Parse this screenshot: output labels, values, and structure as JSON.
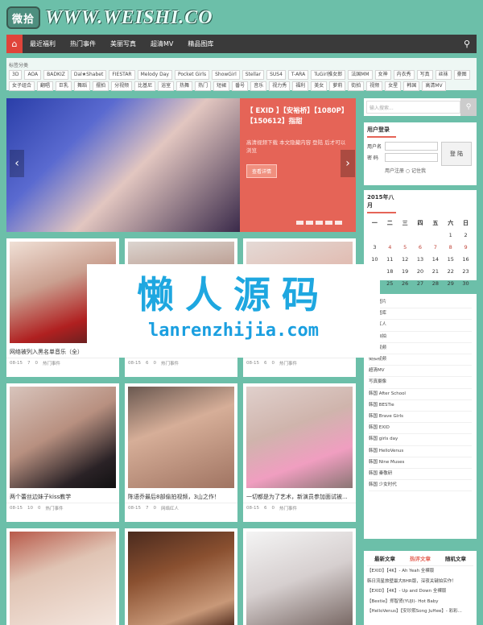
{
  "logo": {
    "badge": "微拾",
    "text": "WWW.WEISHI.CO"
  },
  "nav": {
    "items": [
      "最近福利",
      "热门事件",
      "美丽写真",
      "超清MV",
      "精品图库"
    ]
  },
  "tags": {
    "label": "标签分类",
    "row1": [
      "3D",
      "AOA",
      "BADKIZ",
      "Dal★Shabet",
      "FIESTAR",
      "Melody Day",
      "Pocket Girls",
      "ShowGirl",
      "Stellar",
      "SUS4",
      "T-ARA",
      "TuGirl推女郎",
      "法国MM",
      "女神",
      "内衣秀",
      "写真",
      "丝袜",
      "豪图"
    ],
    "row2": [
      "女子组合",
      "翻唱",
      "巨乳",
      "舞蹈",
      "摆拍",
      "分视频",
      "比基尼",
      "浴室",
      "热舞",
      "热门",
      "短裙",
      "番号",
      "音乐",
      "视力秀",
      "福利",
      "美女",
      "萝莉",
      "街拍",
      "视频",
      "女星",
      "韩国",
      "高清MV"
    ]
  },
  "slider": {
    "title": "【 EXID 】【安裕桥】【1080P】【150612】指甜",
    "desc": "高清视频下载 本文隐藏内容 登陆 后才可以浏览",
    "button": "查看详情"
  },
  "cards": [
    {
      "title": "网络被列入黑名单音乐（全）",
      "date": "08-15",
      "views": "7",
      "comments": "0",
      "cat": "热门事件"
    },
    {
      "title": "",
      "date": "08-15",
      "views": "6",
      "comments": "0",
      "cat": "热门事件"
    },
    {
      "title": "",
      "date": "08-15",
      "views": "6",
      "comments": "0",
      "cat": "热门事件"
    },
    {
      "title": "两个蕾丝边妹子kiss教学",
      "date": "08-15",
      "views": "10",
      "comments": "0",
      "cat": "热门事件"
    },
    {
      "title": "陈语乔最后8部偷拍视频，3山之作！",
      "date": "08-15",
      "views": "7",
      "comments": "0",
      "cat": "网络红人"
    },
    {
      "title": "一切都是为了艺术，新演员参加面试被...",
      "date": "08-15",
      "views": "6",
      "comments": "0",
      "cat": "热门事件"
    },
    {
      "title": "",
      "date": "",
      "views": "",
      "comments": "",
      "cat": ""
    },
    {
      "title": "",
      "date": "",
      "views": "",
      "comments": "",
      "cat": ""
    },
    {
      "title": "",
      "date": "",
      "views": "",
      "comments": "",
      "cat": ""
    }
  ],
  "search": {
    "placeholder": "输入搜索..."
  },
  "login": {
    "title": "用户登录",
    "user": "用户名",
    "pass": "密 码",
    "button": "登 陆",
    "links": "用户注册  ○ 记住我"
  },
  "calendar": {
    "title": "2015年八月",
    "days": [
      "一",
      "二",
      "三",
      "四",
      "五",
      "六",
      "日"
    ],
    "weeks": [
      [
        "",
        "",
        "",
        "",
        "",
        "1",
        "2"
      ],
      [
        "3",
        "4",
        "5",
        "6",
        "7",
        "8",
        "9"
      ],
      [
        "10",
        "11",
        "12",
        "13",
        "14",
        "15",
        "16"
      ],
      [
        "17",
        "18",
        "19",
        "20",
        "21",
        "22",
        "23"
      ],
      [
        "24",
        "25",
        "26",
        "27",
        "28",
        "29",
        "30"
      ]
    ]
  },
  "categories": [
    "福利图片",
    "精品图库",
    "网络红人",
    "潜女自拍",
    "萝莉视频",
    "街拍视频",
    "超清MV",
    "写真摄像",
    "韩国 After School",
    "韩国 BESTie",
    "韩国 Brave Girls",
    "韩国 EXID",
    "韩国 girls day",
    "韩国 HelloVenus",
    "韩国 Nine Muses",
    "韩国 秦敬研",
    "韩国 少女时代"
  ],
  "posts": {
    "tabs": [
      "最新文章",
      "热评文章",
      "随机文章"
    ],
    "items": [
      "【EXID】【4K】- Ah Yeah 全裸版",
      "韩日流星旅壁最大BHR版，深夜关键拍实作！",
      "【EXID】【4K】- Up and Down 全裸版",
      "【Bestie】郑智贤(YUJI)- Hot Baby",
      "【HelloVenus】【安珍熙Song JuHee】- 彩彩..."
    ]
  },
  "watermark": {
    "cn": "懒人源码",
    "en": "lanrenzhijia.com"
  }
}
